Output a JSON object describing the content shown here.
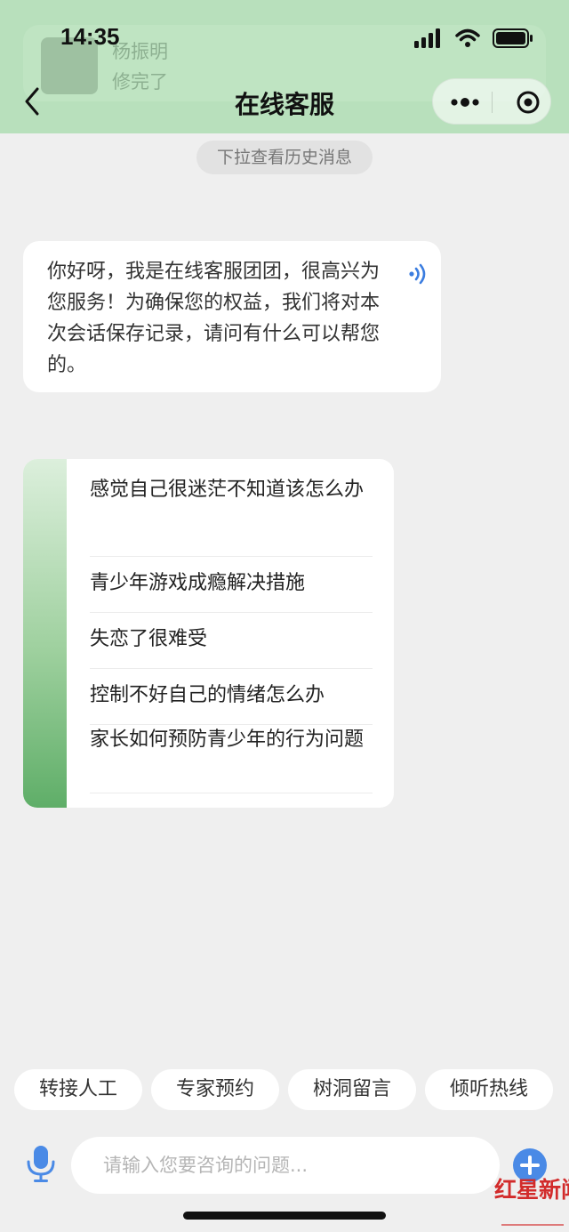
{
  "status_bar": {
    "time": "14:35"
  },
  "notification": {
    "sender": "杨振明",
    "message": "修完了"
  },
  "nav": {
    "title": "在线客服"
  },
  "history_hint": "下拉查看历史消息",
  "welcome_message": "你好呀，我是在线客服团团，很高兴为您服务！为确保您的权益，我们将对本次会话保存记录，请问有什么可以帮您的。",
  "suggestions": [
    "感觉自己很迷茫不知道该怎么办",
    "青少年游戏成瘾解决措施",
    "失恋了很难受",
    "控制不好自己的情绪怎么办",
    "家长如何预防青少年的行为问题"
  ],
  "quick_actions": [
    "转接人工",
    "专家预约",
    "树洞留言",
    "倾听热线"
  ],
  "input": {
    "placeholder": "请输入您要咨询的问题..."
  },
  "watermark": "红星新闻",
  "colors": {
    "header": "#b8e0bc",
    "accent_blue": "#3b7de0",
    "background": "#efefef"
  }
}
